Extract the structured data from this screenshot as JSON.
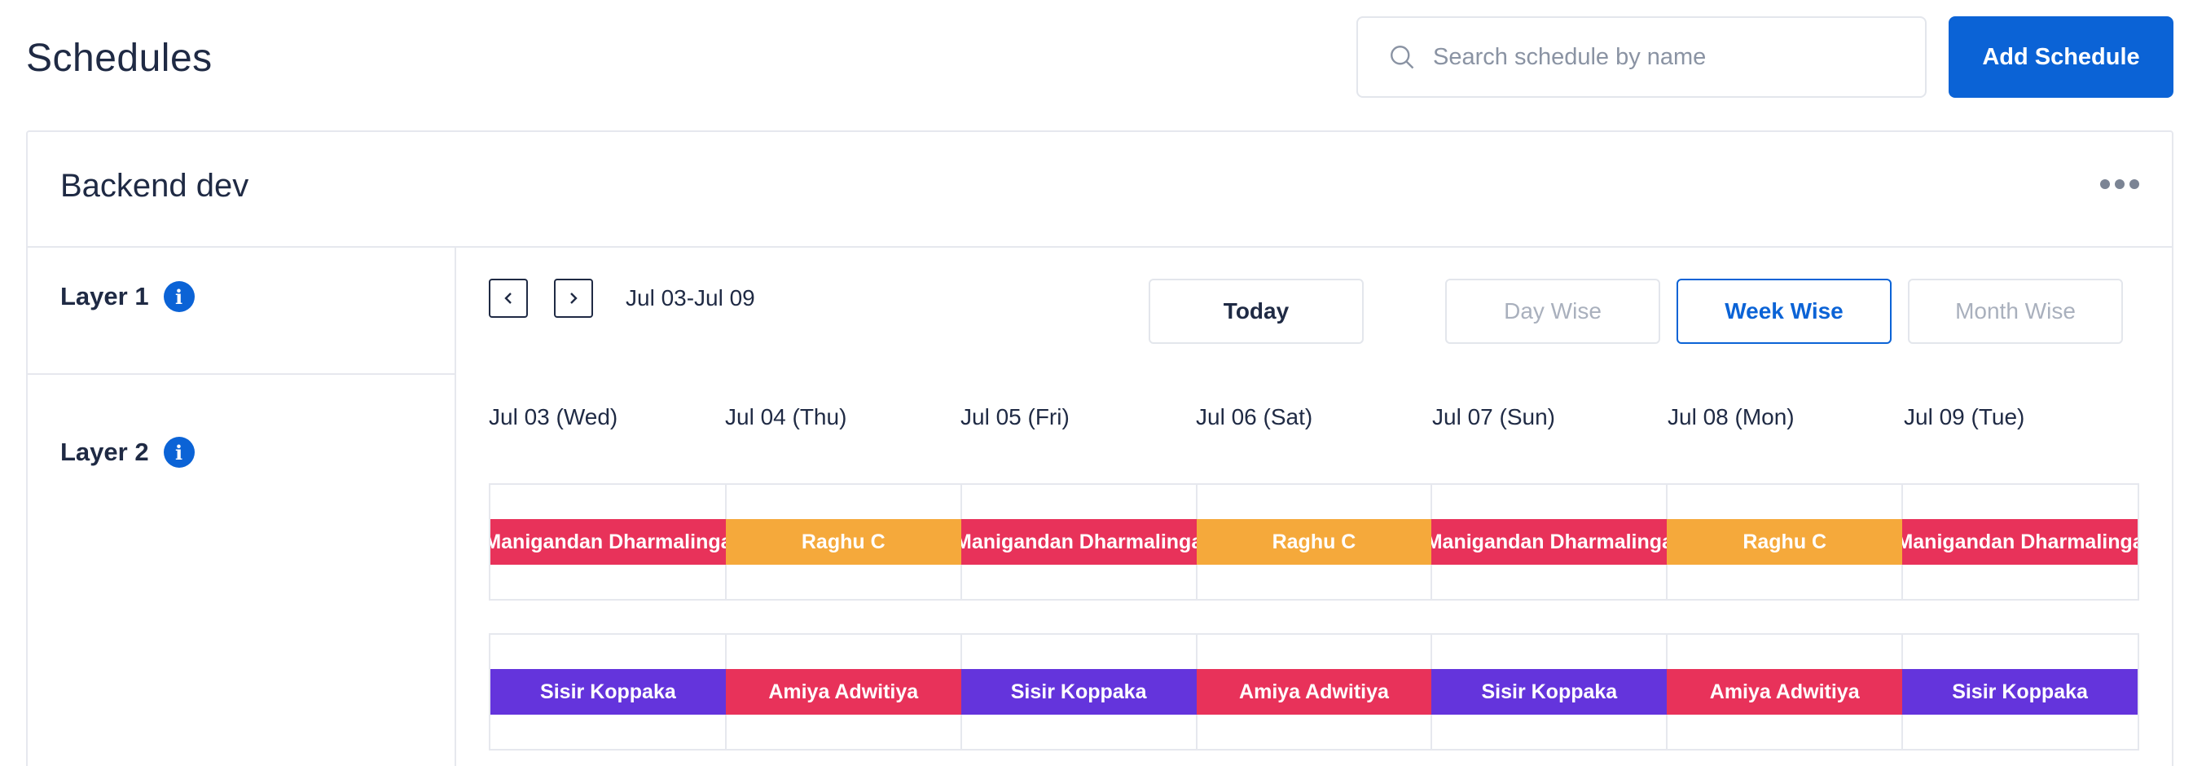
{
  "header": {
    "title": "Schedules",
    "search_placeholder": "Search schedule by name",
    "search_value": "",
    "add_button": "Add Schedule"
  },
  "schedule": {
    "name": "Backend dev",
    "range_label": "Jul 03-Jul 09",
    "view_buttons": {
      "today": "Today",
      "day": "Day Wise",
      "week": "Week Wise",
      "month": "Month Wise"
    },
    "selected_view": "Week Wise",
    "days": [
      "Jul 03 (Wed)",
      "Jul 04 (Thu)",
      "Jul 05 (Fri)",
      "Jul 06 (Sat)",
      "Jul 07 (Sun)",
      "Jul 08 (Mon)",
      "Jul 09 (Tue)"
    ],
    "layers": [
      {
        "label": "Layer 1",
        "shifts": [
          {
            "name": "Manigandan Dharmalinga",
            "color": "#e8325a"
          },
          {
            "name": "Raghu C",
            "color": "#f5a93b"
          },
          {
            "name": "Manigandan Dharmalinga",
            "color": "#e8325a"
          },
          {
            "name": "Raghu C",
            "color": "#f5a93b"
          },
          {
            "name": "Manigandan Dharmalinga",
            "color": "#e8325a"
          },
          {
            "name": "Raghu C",
            "color": "#f5a93b"
          },
          {
            "name": "Manigandan Dharmalinga",
            "color": "#e8325a"
          }
        ]
      },
      {
        "label": "Layer 2",
        "shifts": [
          {
            "name": "Sisir Koppaka",
            "color": "#6434dc"
          },
          {
            "name": "Amiya Adwitiya",
            "color": "#e8325a"
          },
          {
            "name": "Sisir Koppaka",
            "color": "#6434dc"
          },
          {
            "name": "Amiya Adwitiya",
            "color": "#e8325a"
          },
          {
            "name": "Sisir Koppaka",
            "color": "#6434dc"
          },
          {
            "name": "Amiya Adwitiya",
            "color": "#e8325a"
          },
          {
            "name": "Sisir Koppaka",
            "color": "#6434dc"
          }
        ]
      }
    ]
  },
  "colors": {
    "accent": "#0b63d6",
    "text": "#1f2a44",
    "border": "#e6e8ee"
  }
}
